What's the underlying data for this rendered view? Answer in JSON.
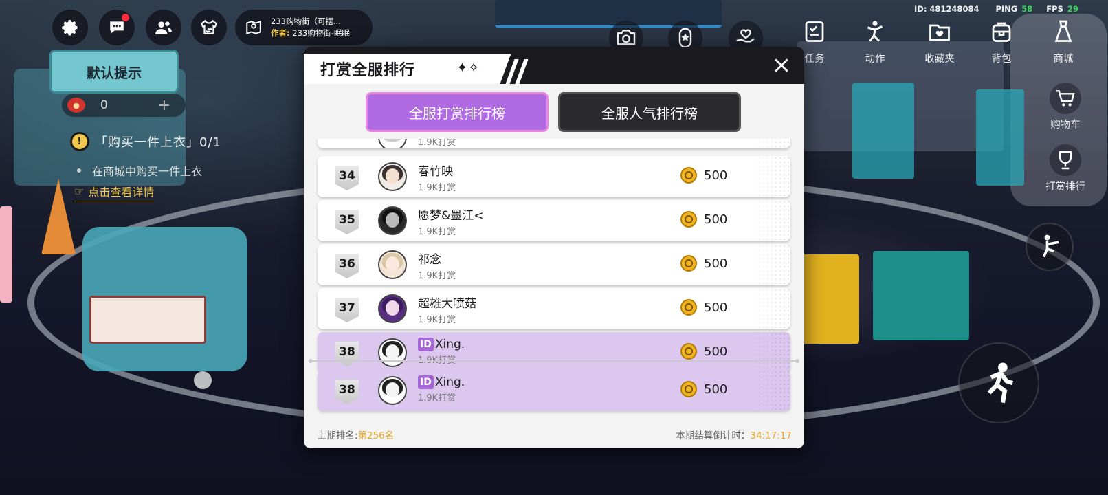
{
  "hud": {
    "map_title": "233购物街（可摆...",
    "author_label": "作者:",
    "author_name": "233购物街-眠眠",
    "id_text": "ID: 481248084",
    "ping_label": "PING",
    "ping_value": "58",
    "fps_label": "FPS",
    "fps_value": "29",
    "top_icons": [
      "camera-icon",
      "badge-icon",
      "heart-hand-icon"
    ],
    "tools": [
      "任务",
      "动作",
      "收藏夹",
      "背包",
      "商城"
    ],
    "side_tools": [
      "购物车",
      "打赏排行"
    ]
  },
  "quest": {
    "sign": "默认提示",
    "currency_value": "0",
    "currency_plus": "+",
    "title": "「购买一件上衣」0/1",
    "step": "在商城中购买一件上衣",
    "link": "点击查看详情"
  },
  "modal": {
    "title": "打赏全服排行",
    "tabs": {
      "active": "全服打赏排行榜",
      "inactive": "全服人气排行榜"
    },
    "partial_row_sub": "1.9K打赏",
    "rows": [
      {
        "rank": "34",
        "name": "春竹映",
        "sub": "1.9K打赏",
        "amount": "500",
        "id_tag": ""
      },
      {
        "rank": "35",
        "name": "愿梦&墨江<",
        "sub": "1.9K打赏",
        "amount": "500",
        "id_tag": ""
      },
      {
        "rank": "36",
        "name": "祁念",
        "sub": "1.9K打赏",
        "amount": "500",
        "id_tag": ""
      },
      {
        "rank": "37",
        "name": "超雄大喷菇",
        "sub": "1.9K打赏",
        "amount": "500",
        "id_tag": ""
      },
      {
        "rank": "38",
        "name": "Xing.",
        "sub": "1.9K打赏",
        "amount": "500",
        "id_tag": "ID"
      }
    ],
    "my_row": {
      "rank": "38",
      "name": "Xing.",
      "sub": "1.9K打赏",
      "amount": "500",
      "id_tag": "ID"
    },
    "footer": {
      "last_rank_label": "上期排名:",
      "last_rank_value": "第256名",
      "countdown_label": "本期结算倒计时：",
      "countdown_value": "34:17:17"
    }
  },
  "colors": {
    "accent_purple": "#b06be3",
    "gold": "#e3a52a",
    "highlight_row": "#dcc8ef"
  }
}
